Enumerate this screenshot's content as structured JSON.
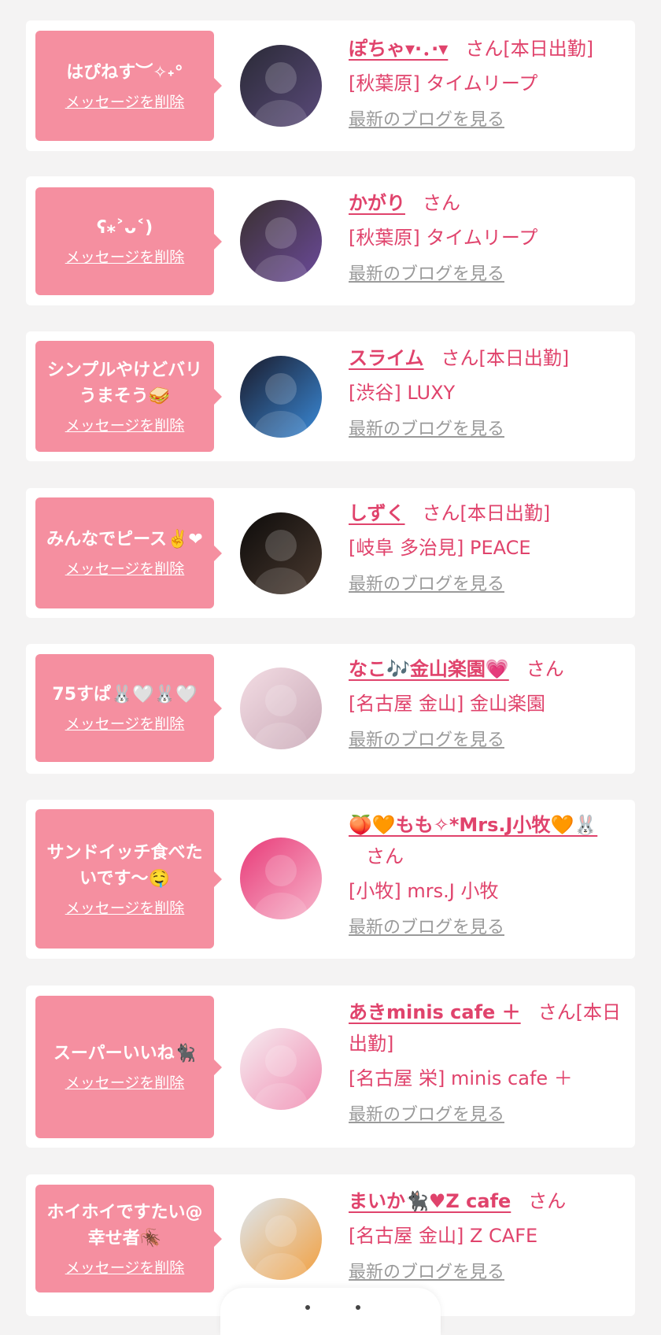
{
  "colors": {
    "background": "#f4f3f3",
    "bubble": "#f58fa0",
    "name": "#e0436c",
    "blog_link": "#9a9a9a"
  },
  "items": [
    {
      "message": "はぴねす︶✧˖°",
      "delete_label": "メッセージを削除",
      "name": "ぽちゃ▾·．·▾",
      "suffix": "さん[本日出勤]",
      "shop": "[秋葉原] タイムリープ",
      "blog_label": "最新のブログを見る"
    },
    {
      "message": "ʕ⁎˃ᴗ˂)",
      "delete_label": "メッセージを削除",
      "name": "かがり",
      "suffix": "さん",
      "shop": "[秋葉原] タイムリープ",
      "blog_label": "最新のブログを見る"
    },
    {
      "message": "シンプルやけどバリうまそう🥪",
      "delete_label": "メッセージを削除",
      "name": "スライム",
      "suffix": "さん[本日出勤]",
      "shop": "[渋谷] LUXY",
      "blog_label": "最新のブログを見る"
    },
    {
      "message": "みんなでピース✌️❤",
      "delete_label": "メッセージを削除",
      "name": "しずく",
      "suffix": "さん[本日出勤]",
      "shop": "[岐阜 多治見] PEACE",
      "blog_label": "最新のブログを見る"
    },
    {
      "message": "75すぱ🐰🤍🐰🤍",
      "delete_label": "メッセージを削除",
      "name": "なこ🎶金山楽園💗",
      "suffix": "さん",
      "shop": "[名古屋 金山] 金山楽園",
      "blog_label": "最新のブログを見る"
    },
    {
      "message": "サンドイッチ食べたいです〜🤤",
      "delete_label": "メッセージを削除",
      "name": "🍑🧡もも✧*Mrs.J小牧🧡🐰",
      "suffix": "さん",
      "shop": "[小牧] mrs.J 小牧",
      "blog_label": "最新のブログを見る"
    },
    {
      "message": "スーパーいいね🐈‍⬛",
      "delete_label": "メッセージを削除",
      "name": "あきminis cafe ＋",
      "suffix": "さん[本日出勤]",
      "shop": "[名古屋 栄] minis cafe ＋",
      "blog_label": "最新のブログを見る"
    },
    {
      "message": "ホイホイですたい@幸せ者🪳",
      "delete_label": "メッセージを削除",
      "name": "まいか🐈‍⬛♥Z cafe",
      "suffix": "さん",
      "shop": "[名古屋 金山] Z CAFE",
      "blog_label": "最新のブログを見る"
    }
  ]
}
